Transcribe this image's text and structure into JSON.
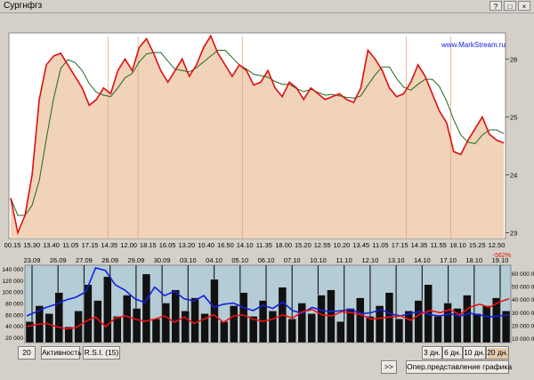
{
  "window": {
    "title": "Сургнфгз",
    "buttons": [
      "?",
      "□",
      "×"
    ]
  },
  "brand": "www.MarkStream.ru",
  "percent_label": "-562%",
  "toolbar": {
    "period_value": "20",
    "activity_label": "Активность",
    "rsi_label": "R.S.I. (15)",
    "range_buttons": [
      "3 дн.",
      "6 дн.",
      "10 дн.",
      "20 дн."
    ],
    "active_range": "20 дн.",
    "scroll_label": ">>",
    "representation_label": "Опер.представление графика"
  },
  "colors": {
    "area_fill": "#f0d3b8",
    "price_line": "#dd1111",
    "ma_line": "#226622",
    "sessions_line": "#e89a7a",
    "volume_bg": "#b4ccd6",
    "blue_series": "#1122dd",
    "red_series": "#ee1111"
  },
  "chart_data": [
    {
      "type": "line",
      "title": "",
      "x_ticks": [
        "00.15",
        "15.30",
        "13.40",
        "11.05",
        "17.15",
        "14.35",
        "12.00",
        "18.15",
        "16.05",
        "13.20",
        "10.40",
        "16.50",
        "14.10",
        "11.35",
        "18.00",
        "15.20",
        "12.55",
        "10.20",
        "13.45",
        "11.05",
        "17.15",
        "14.35",
        "11.55",
        "18.10",
        "15.25",
        "12.50"
      ],
      "y_ticks": [
        23,
        24,
        25,
        26
      ],
      "ylim": [
        22.9,
        26.45
      ],
      "series": [
        {
          "role": "price",
          "values": [
            23.6,
            23.0,
            23.3,
            24.0,
            25.3,
            25.9,
            26.05,
            26.1,
            25.9,
            25.7,
            25.5,
            25.2,
            25.3,
            25.5,
            25.4,
            25.8,
            26.0,
            25.8,
            26.2,
            26.35,
            26.1,
            25.8,
            25.6,
            25.8,
            26.0,
            25.7,
            25.9,
            26.2,
            26.4,
            26.1,
            25.9,
            25.7,
            25.9,
            25.8,
            25.55,
            25.6,
            25.8,
            25.5,
            25.35,
            25.6,
            25.5,
            25.3,
            25.5,
            25.4,
            25.3,
            25.35,
            25.4,
            25.3,
            25.25,
            25.5,
            26.15,
            26.0,
            25.8,
            25.5,
            25.35,
            25.4,
            25.6,
            25.9,
            25.7,
            25.4,
            25.1,
            24.9,
            24.4,
            24.35,
            24.6,
            24.8,
            25.0,
            24.7,
            24.6,
            24.55
          ]
        }
      ]
    },
    {
      "type": "line",
      "x_ticks": [
        "23.09",
        "26.09",
        "27.09",
        "28.09",
        "29.09",
        "30.09",
        "03.10",
        "04.10",
        "05.10",
        "06.10",
        "07.10",
        "10.10",
        "11.10",
        "12.10",
        "13.10",
        "14.10",
        "17.10",
        "18.10",
        "19.10"
      ],
      "y_left_ticks": [
        "140 000",
        "120 000",
        "100 000",
        "80 000",
        "60 000",
        "40 000",
        "20 000"
      ],
      "y_right_ticks": [
        "60 000 0",
        "50 000 0",
        "40 000 0",
        "30 000 0",
        "20 000 0",
        "10 000 0"
      ],
      "series": [
        {
          "role": "blue",
          "values": [
            50,
            58,
            66,
            72,
            80,
            85,
            95,
            140,
            135,
            108,
            98,
            82,
            75,
            104,
            88,
            96,
            82,
            78,
            88,
            66,
            72,
            74,
            66,
            60,
            70,
            64,
            76,
            60,
            55,
            66,
            60,
            58,
            60,
            62,
            54,
            56,
            62,
            54,
            50,
            55,
            58,
            52,
            50,
            54,
            50,
            55,
            52,
            48,
            50,
            52
          ]
        },
        {
          "role": "red",
          "values": [
            30,
            34,
            36,
            30,
            26,
            28,
            40,
            48,
            30,
            46,
            50,
            44,
            40,
            44,
            50,
            38,
            48,
            36,
            44,
            52,
            38,
            50,
            52,
            44,
            40,
            44,
            52,
            46,
            58,
            62,
            52,
            50,
            58,
            56,
            52,
            44,
            46,
            48,
            50,
            42,
            54,
            60,
            56,
            62,
            52,
            66,
            72,
            66,
            76,
            82
          ]
        },
        {
          "role": "volume",
          "values": [
            40,
            70,
            55,
            95,
            30,
            60,
            110,
            80,
            125,
            50,
            90,
            65,
            130,
            45,
            75,
            100,
            60,
            85,
            55,
            120,
            40,
            70,
            95,
            50,
            80,
            60,
            105,
            45,
            75,
            55,
            90,
            100,
            40,
            65,
            85,
            50,
            70,
            95,
            45,
            60,
            80,
            110,
            50,
            75,
            65,
            90,
            55,
            70,
            85,
            60
          ]
        }
      ]
    }
  ]
}
